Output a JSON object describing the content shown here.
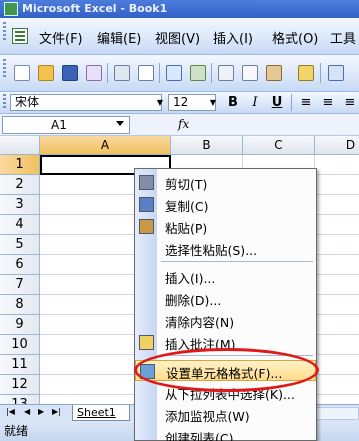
{
  "titlebar": {
    "text": "Microsoft Excel - Book1"
  },
  "menubar": {
    "items": [
      "文件(F)",
      "编辑(E)",
      "视图(V)",
      "插入(I)",
      "格式(O)",
      "工具"
    ]
  },
  "formatbar": {
    "font_name": "宋体",
    "font_size": "12",
    "bold": "B",
    "italic": "I",
    "underline": "U"
  },
  "formulabar": {
    "name_box": "A1",
    "fx": "fx"
  },
  "grid": {
    "columns": [
      "A",
      "B",
      "C",
      "D"
    ],
    "rows": [
      "1",
      "2",
      "3",
      "4",
      "5",
      "6",
      "7",
      "8",
      "9",
      "10",
      "11",
      "12",
      "13"
    ],
    "active_cell": "A1"
  },
  "context_menu": {
    "items": [
      {
        "label": "剪切(T)",
        "icon": "scissors-icon"
      },
      {
        "label": "复制(C)",
        "icon": "copy-icon"
      },
      {
        "label": "粘贴(P)",
        "icon": "paste-icon"
      },
      {
        "label": "选择性粘贴(S)...",
        "icon": ""
      },
      {
        "label": "插入(I)...",
        "icon": ""
      },
      {
        "label": "删除(D)...",
        "icon": ""
      },
      {
        "label": "清除内容(N)",
        "icon": ""
      },
      {
        "label": "插入批注(M)",
        "icon": "comment-icon"
      },
      {
        "label": "设置单元格格式(F)...",
        "icon": "format-cells-icon"
      },
      {
        "label": "从下拉列表中选择(K)...",
        "icon": ""
      },
      {
        "label": "添加监视点(W)",
        "icon": ""
      },
      {
        "label": "创建列表(C)...",
        "icon": ""
      }
    ]
  },
  "sheet_tabs": {
    "active": "Sheet1",
    "nav": [
      "|◀",
      "◀",
      "▶",
      "▶|"
    ]
  },
  "statusbar": {
    "text": "就绪"
  },
  "colors": {
    "title": "#1d4fc2",
    "highlight": "#ffdc8a",
    "annotation": "#e01818"
  }
}
